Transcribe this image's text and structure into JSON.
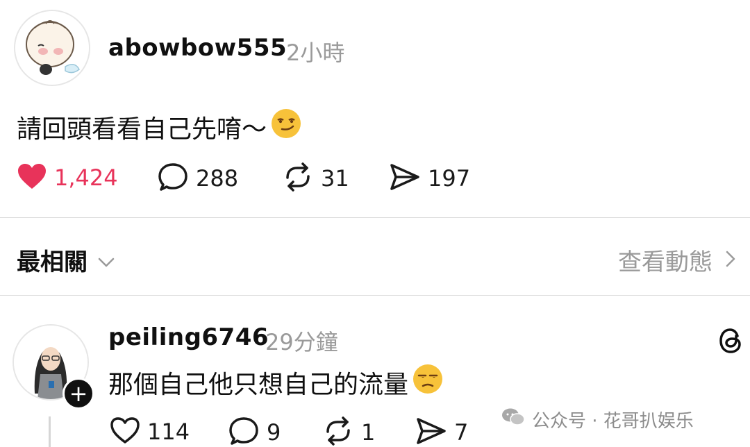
{
  "post": {
    "username": "abowbow555",
    "timestamp": "2小時",
    "text": "請回頭看看自己先唷～",
    "emoji": "smirking-face",
    "likes": "1,424",
    "replies": "288",
    "reposts": "31",
    "shares": "197",
    "liked": true
  },
  "sort": {
    "label": "最相關",
    "activity_link": "查看動態"
  },
  "reply": {
    "username": "peiling6746",
    "timestamp": "29分鐘",
    "text": "那個自己他只想自己的流量",
    "emoji": "unamused-face",
    "likes": "114",
    "replies": "9",
    "reposts": "1",
    "shares": "7"
  },
  "watermark": {
    "text": "公众号 · 花哥扒娱乐"
  },
  "colors": {
    "like_red": "#e8335a",
    "muted_gray": "#9a9a9a",
    "text_dark": "#101010"
  }
}
